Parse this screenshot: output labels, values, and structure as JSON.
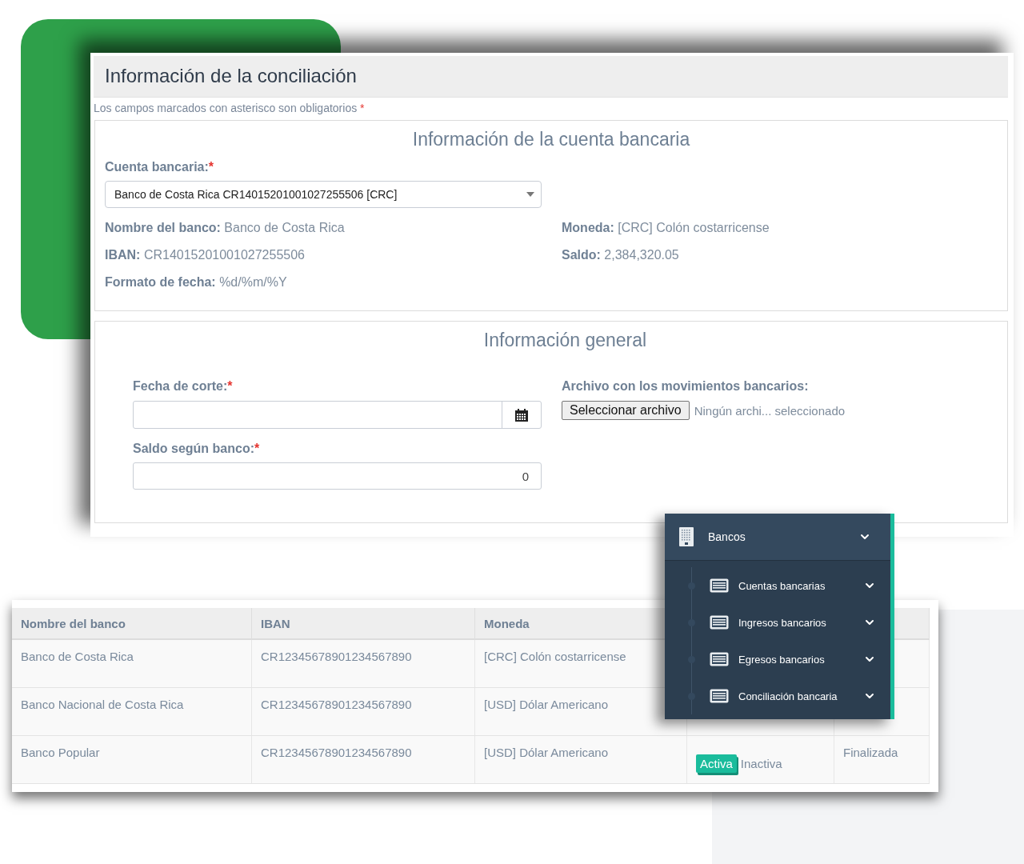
{
  "form": {
    "title": "Información de la conciliación",
    "required_note": "Los campos marcados con asterisco son obligatorios",
    "required_mark": "*",
    "account_section": {
      "title": "Información de la cuenta bancaria",
      "account_label": "Cuenta bancaria:",
      "account_value": "Banco de Costa Rica CR14015201001027255506 [CRC]",
      "details_left": [
        {
          "label": "Nombre del banco:",
          "value": "Banco de Costa Rica"
        },
        {
          "label": "IBAN:",
          "value": "CR14015201001027255506"
        },
        {
          "label": "Formato de fecha:",
          "value": "%d/%m/%Y"
        }
      ],
      "details_right": [
        {
          "label": "Moneda:",
          "value": "[CRC] Colón costarricense"
        },
        {
          "label": "Saldo:",
          "value": "2,384,320.05"
        }
      ]
    },
    "general_section": {
      "title": "Información general",
      "cutoff_label": "Fecha de corte:",
      "balance_label": "Saldo según banco:",
      "balance_value": "0",
      "file_label": "Archivo con los movimientos bancarios:",
      "file_button": "Seleccionar archivo",
      "file_status": "Ningún archi... seleccionado"
    }
  },
  "table": {
    "columns": [
      "Nombre del banco",
      "IBAN",
      "Moneda"
    ],
    "rows": [
      {
        "cells": [
          "Banco de Costa Rica",
          "CR12345678901234567890",
          "[CRC] Colón costarricense"
        ]
      },
      {
        "cells": [
          "Banco Nacional de Costa Rica",
          "CR12345678901234567890",
          "[USD] Dólar Americano"
        ]
      },
      {
        "cells": [
          "Banco Popular",
          "CR12345678901234567890",
          "[USD] Dólar Americano"
        ],
        "status": [
          {
            "label": "Activa",
            "selected": true
          },
          {
            "label": "Inactiva",
            "selected": false
          }
        ],
        "column_5": "Finalizada"
      }
    ]
  },
  "menu": {
    "title": "Bancos",
    "items": [
      "Cuentas bancarias",
      "Ingresos bancarios",
      "Egresos bancarios",
      "Conciliación bancaria"
    ]
  }
}
